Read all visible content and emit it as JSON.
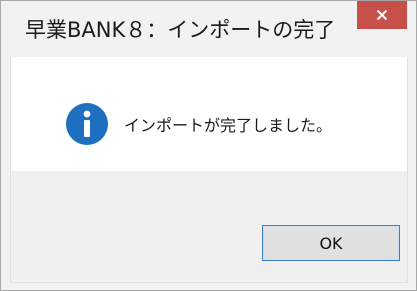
{
  "window": {
    "title": "早業BANK８：インポートの完了"
  },
  "dialog": {
    "message": "インポートが完了しました。",
    "ok_label": "OK",
    "icon": "information-icon"
  },
  "colors": {
    "close_button_bg": "#c7504b",
    "info_icon_blue": "#1f6fc1",
    "ok_border": "#3c7fd2"
  }
}
